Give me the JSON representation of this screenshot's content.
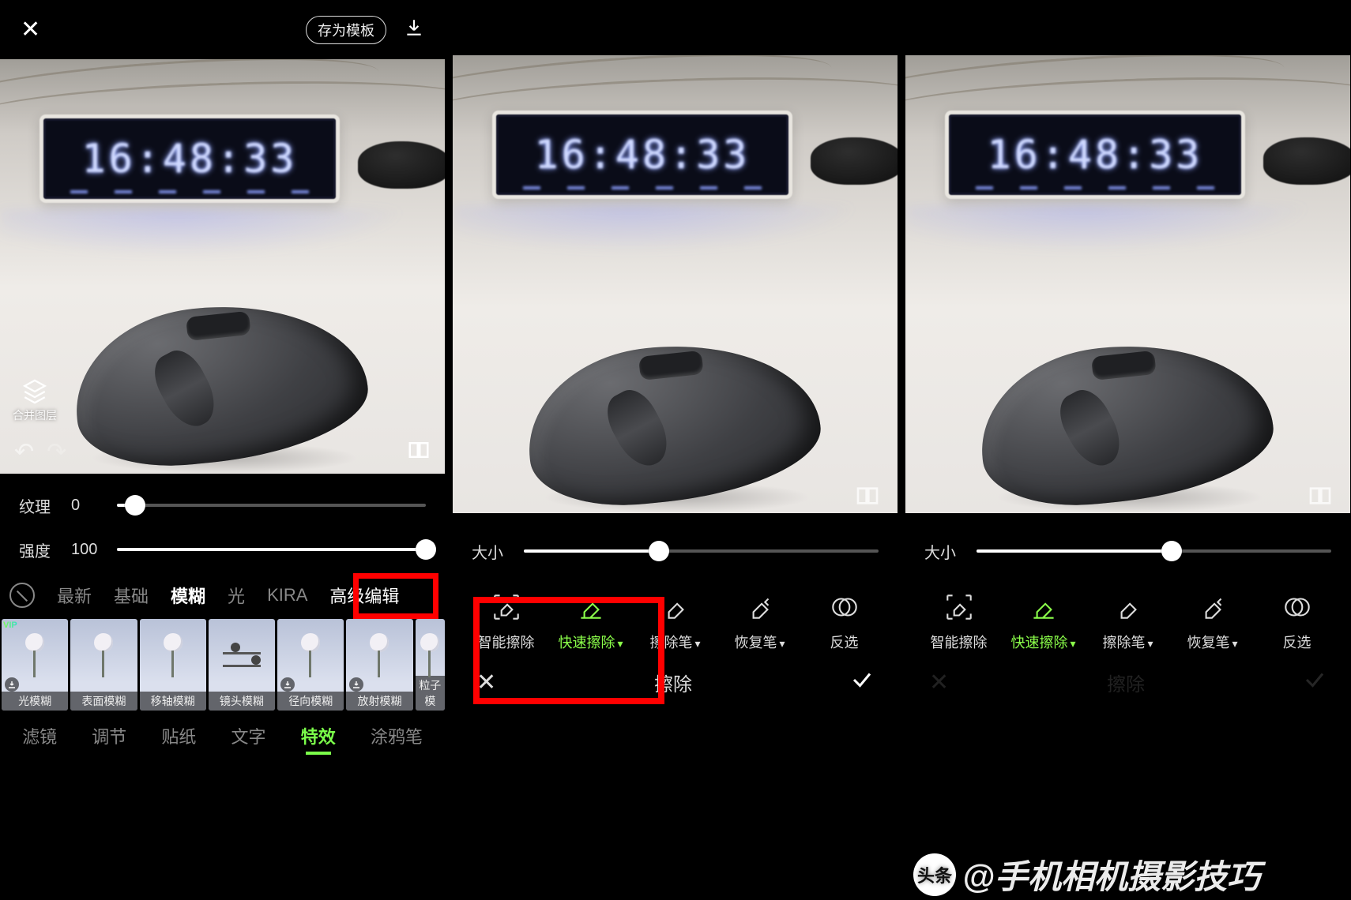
{
  "panel1": {
    "topbar": {
      "save_template": "存为模板"
    },
    "clock_time": "16:48:33",
    "layer_label": "合并图层",
    "sliders": {
      "texture": {
        "label": "纹理",
        "value": "0",
        "pct": 6
      },
      "strength": {
        "label": "强度",
        "value": "100",
        "pct": 100
      }
    },
    "categories": [
      "最新",
      "基础",
      "模糊",
      "光",
      "KIRA",
      "高级编辑"
    ],
    "category_active_index": 2,
    "thumbs": [
      "光模糊",
      "表面模糊",
      "移轴模糊",
      "镜头模糊",
      "径向模糊",
      "放射模糊",
      "粒子模"
    ],
    "bottom_tabs": [
      "滤镜",
      "调节",
      "贴纸",
      "文字",
      "特效",
      "涂鸦笔"
    ],
    "bottom_active_index": 4
  },
  "erase": {
    "clock_time": "16:48:33",
    "size_label": "大小",
    "size_pct_p2": 38,
    "size_pct_p3": 55,
    "tools": [
      {
        "key": "smart",
        "label": "智能擦除"
      },
      {
        "key": "quick",
        "label": "快速擦除",
        "caret": true,
        "active": true
      },
      {
        "key": "brush",
        "label": "擦除笔",
        "caret": true
      },
      {
        "key": "restore",
        "label": "恢复笔",
        "caret": true
      },
      {
        "key": "invert",
        "label": "反选"
      }
    ],
    "footer_title": "擦除"
  },
  "watermark": {
    "logo": "头条",
    "text": "@手机相机摄影技巧"
  }
}
